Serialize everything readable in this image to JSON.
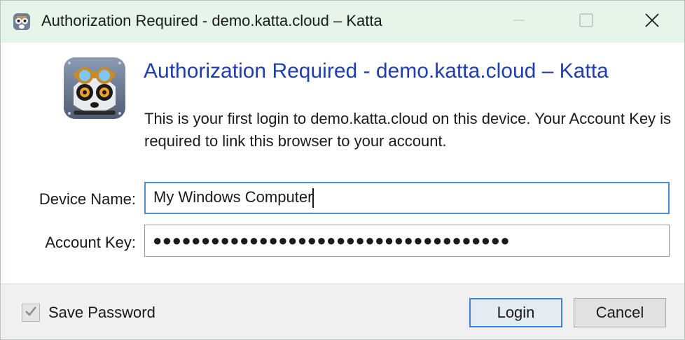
{
  "window": {
    "title": "Authorization Required - demo.katta.cloud – Katta",
    "app_icon": "lemur-with-goggles-icon"
  },
  "dialog": {
    "heading": "Authorization Required - demo.katta.cloud – Katta",
    "description": "This is your first login to demo.katta.cloud on this device. Your Account Key is required to link this browser to your account."
  },
  "form": {
    "device_name_label": "Device Name:",
    "device_name_value": "My Windows Computer",
    "account_key_label": "Account Key:",
    "account_key_masked": "●●●●●●●●●●●●●●●●●●●●●●●●●●●●●●●●●●●●●"
  },
  "footer": {
    "save_password_label": "Save Password",
    "save_password_checked": true,
    "login_label": "Login",
    "cancel_label": "Cancel"
  },
  "colors": {
    "titlebar_bg": "#e7f4ea",
    "heading": "#1f3fb0",
    "focus_border": "#4a8fd6"
  }
}
